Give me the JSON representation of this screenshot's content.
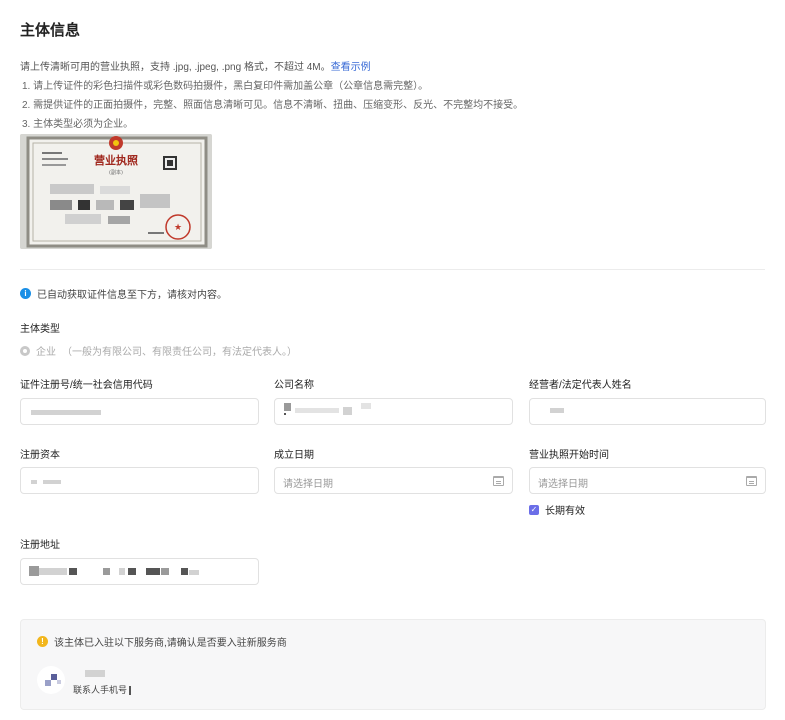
{
  "page": {
    "title": "主体信息"
  },
  "upload_notes": {
    "intro": "请上传清晰可用的营业执照，支持 .jpg, .jpeg, .png 格式，不超过 4M。",
    "example_link": "查看示例",
    "rules": [
      "1. 请上传证件的彩色扫描件或彩色数码拍摄件，黑白复印件需加盖公章（公章信息需完整）。",
      "2. 需提供证件的正面拍摄件，完整、照面信息清晰可见。信息不清晰、扭曲、压缩变形、反光、不完整均不接受。",
      "3. 主体类型必须为企业。"
    ]
  },
  "license_image": {
    "heading": "营业执照",
    "sub": "(副本)"
  },
  "auto_fill_tip": "已自动获取证件信息至下方，请核对内容。",
  "subject_type": {
    "label": "主体类型",
    "option": "企业",
    "option_hint": "（一般为有限公司、有限责任公司，有法定代表人。）"
  },
  "fields": {
    "reg_number_label": "证件注册号/统一社会信用代码",
    "company_name_label": "公司名称",
    "legal_rep_label": "经营者/法定代表人姓名",
    "reg_capital_label": "注册资本",
    "establish_date_label": "成立日期",
    "establish_date_placeholder": "请选择日期",
    "license_start_label": "营业执照开始时间",
    "license_start_placeholder": "请选择日期",
    "long_term_label": "长期有效",
    "long_term_checked": true,
    "address_label": "注册地址"
  },
  "provider_notice": {
    "message": "该主体已入驻以下服务商,请确认是否要入驻新服务商",
    "contact_label": "联系人手机号"
  },
  "colors": {
    "accent": "#6b6ee8",
    "info": "#1a8fe6",
    "warning": "#f2b61c",
    "link": "#3a6bd6"
  }
}
